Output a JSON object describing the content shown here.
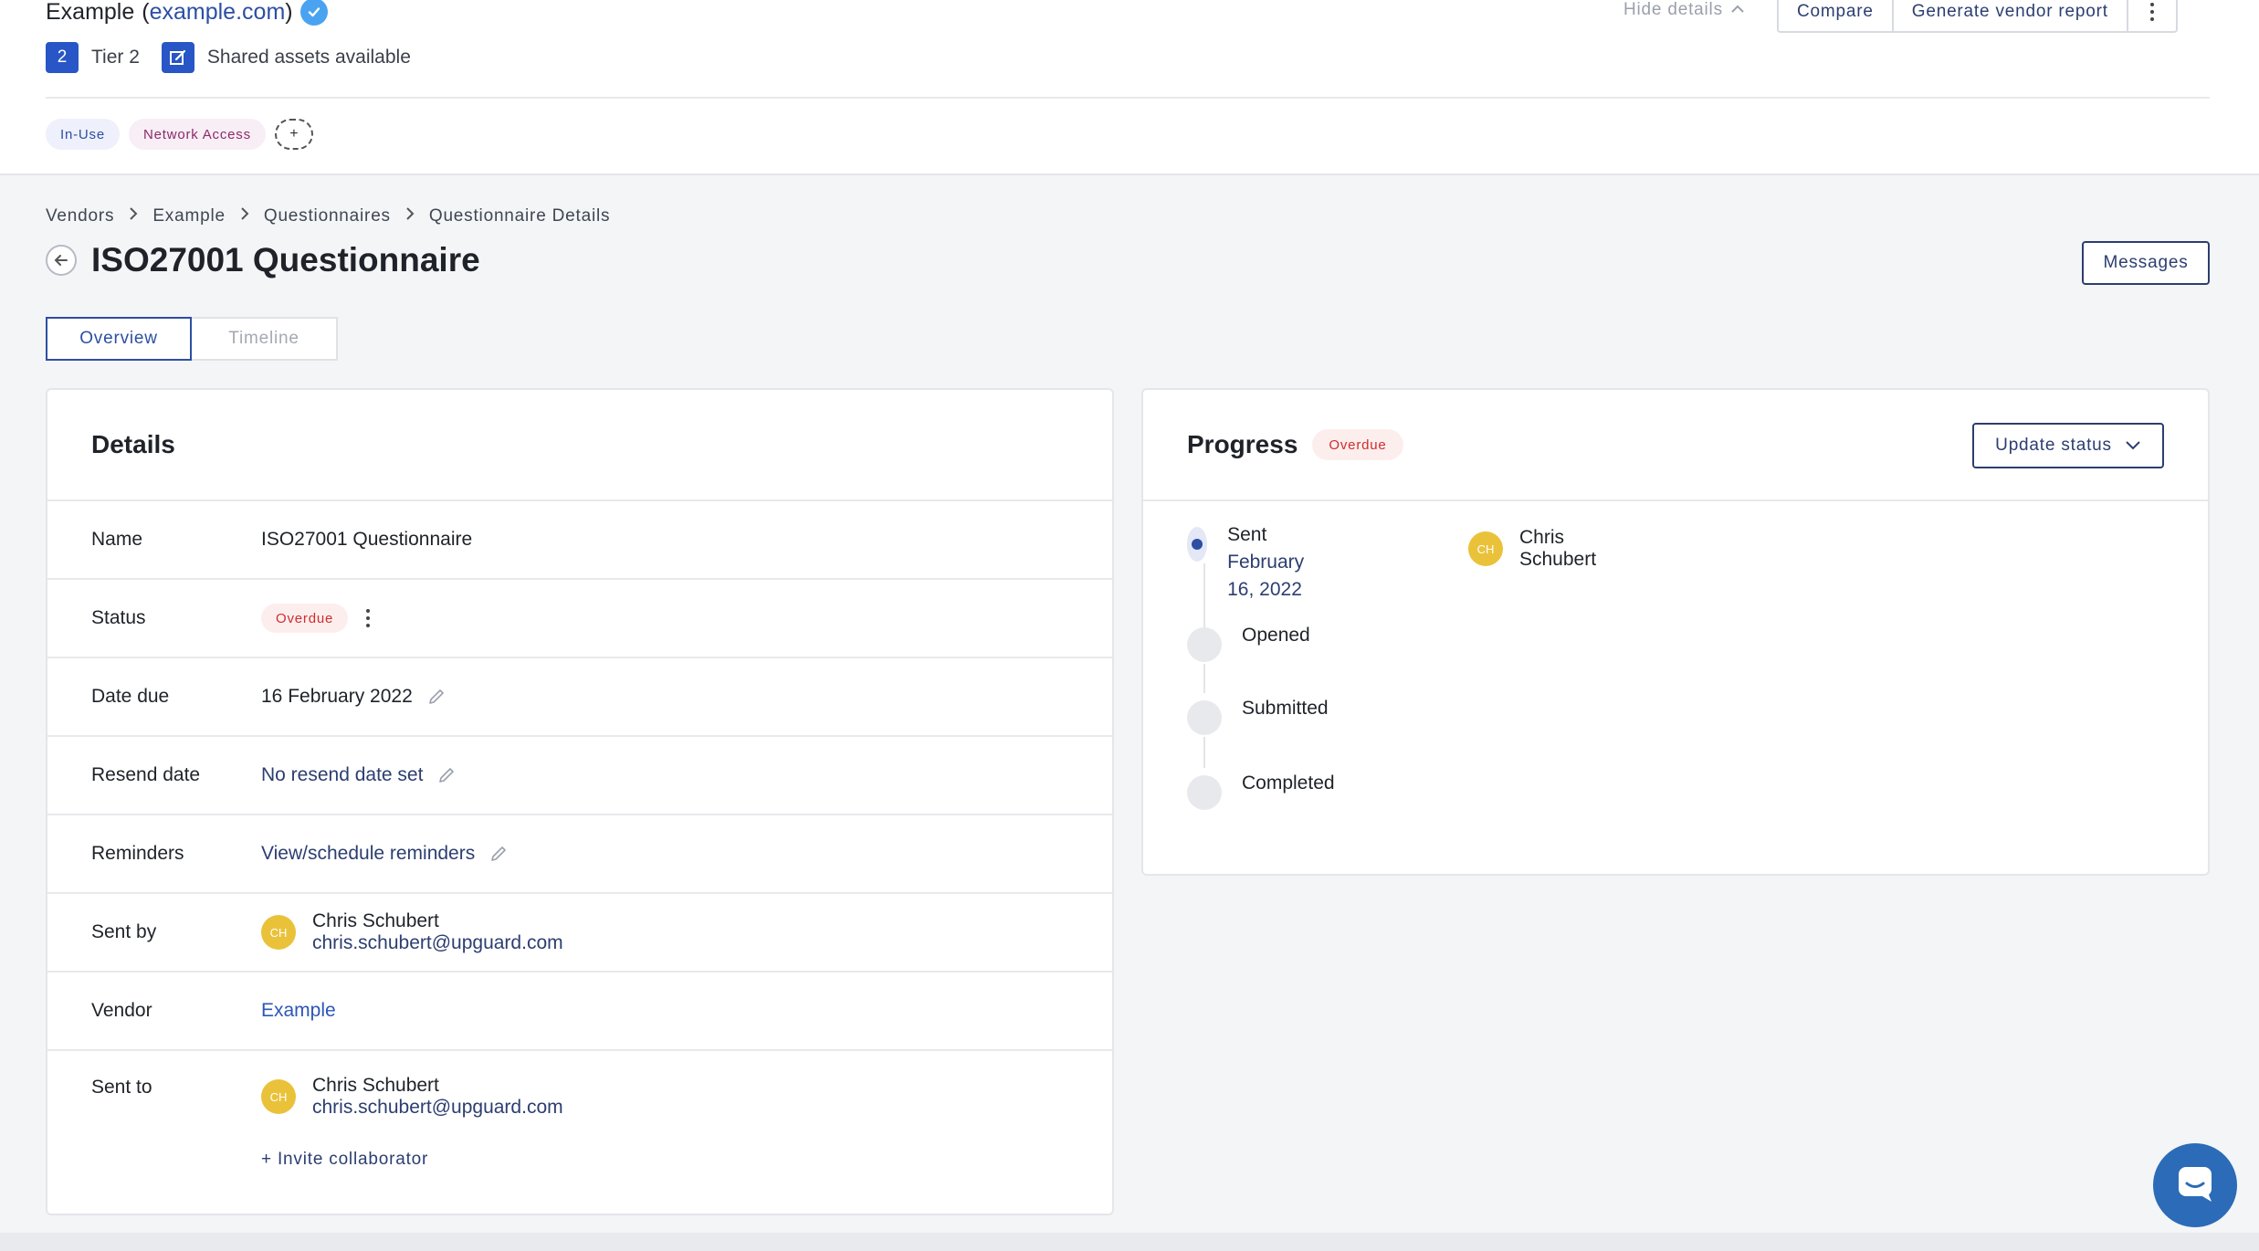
{
  "vendor": {
    "name": "Example",
    "domain_open": "(",
    "domain": "example.com",
    "domain_close": ")",
    "tier_number": "2",
    "tier_label": "Tier 2",
    "shared_assets": "Shared assets available",
    "tags": [
      "In-Use",
      "Network Access"
    ],
    "add_tag": "+"
  },
  "header_actions": {
    "hide_details": "Hide details",
    "compare": "Compare",
    "generate_report": "Generate vendor report"
  },
  "breadcrumb": [
    "Vendors",
    "Example",
    "Questionnaires",
    "Questionnaire Details"
  ],
  "page": {
    "title": "ISO27001 Questionnaire",
    "messages_button": "Messages"
  },
  "tabs": [
    {
      "label": "Overview",
      "active": true
    },
    {
      "label": "Timeline",
      "active": false
    }
  ],
  "details": {
    "title": "Details",
    "rows": {
      "name": {
        "label": "Name",
        "value": "ISO27001 Questionnaire"
      },
      "status": {
        "label": "Status",
        "value": "Overdue"
      },
      "date_due": {
        "label": "Date due",
        "value": "16 February 2022"
      },
      "resend_date": {
        "label": "Resend date",
        "value": "No resend date set"
      },
      "reminders": {
        "label": "Reminders",
        "value": "View/schedule reminders"
      },
      "sent_by": {
        "label": "Sent by",
        "initials": "CH",
        "name": "Chris Schubert",
        "email": "chris.schubert@upguard.com"
      },
      "vendor": {
        "label": "Vendor",
        "value": "Example"
      },
      "sent_to": {
        "label": "Sent to",
        "initials": "CH",
        "name": "Chris Schubert",
        "email": "chris.schubert@upguard.com",
        "invite": "+ Invite collaborator"
      }
    }
  },
  "progress": {
    "title": "Progress",
    "status": "Overdue",
    "update_button": "Update status",
    "steps": [
      {
        "label": "Sent",
        "date": "February 16, 2022",
        "current": true
      },
      {
        "label": "Opened"
      },
      {
        "label": "Submitted"
      },
      {
        "label": "Completed"
      }
    ],
    "assignee": {
      "initials": "CH",
      "name": "Chris Schubert"
    }
  },
  "colors": {
    "accent": "#2c4fa3",
    "overdue": "#d12c2c",
    "avatar": "#eac23a",
    "chat": "#2b6bb7"
  },
  "icons": [
    "verified-check-icon",
    "shared-assets-icon",
    "chevron-up-icon",
    "kebab-menu-icon",
    "chevron-right-icon",
    "back-arrow-icon",
    "pencil-icon",
    "chevron-down-icon",
    "chat-icon"
  ]
}
